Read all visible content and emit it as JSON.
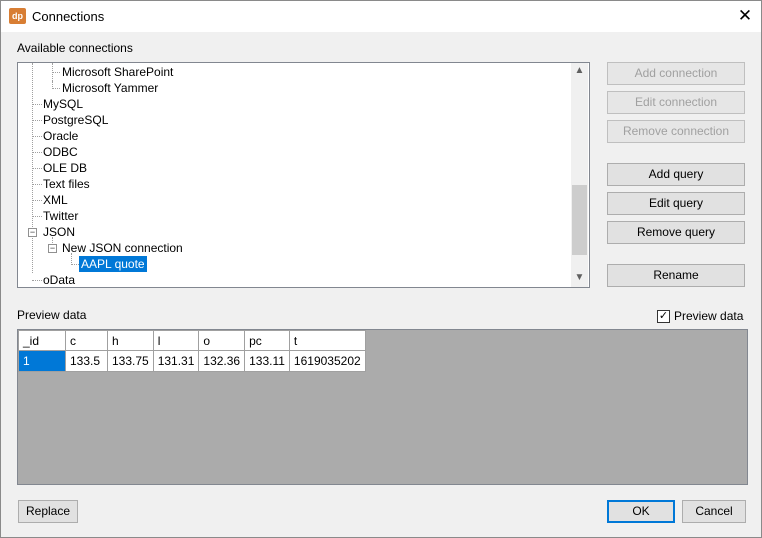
{
  "window": {
    "title": "Connections",
    "app_icon": "dp",
    "close_glyph": "✕"
  },
  "connections": {
    "label": "Available connections",
    "items": [
      {
        "label": "Microsoft SharePoint"
      },
      {
        "label": "Microsoft Yammer"
      },
      {
        "label": "MySQL"
      },
      {
        "label": "PostgreSQL"
      },
      {
        "label": "Oracle"
      },
      {
        "label": "ODBC"
      },
      {
        "label": "OLE DB"
      },
      {
        "label": "Text files"
      },
      {
        "label": "XML"
      },
      {
        "label": "Twitter"
      },
      {
        "label": "JSON"
      },
      {
        "label": "New JSON connection"
      },
      {
        "label": "AAPL quote",
        "selected": true
      },
      {
        "label": "oData"
      }
    ]
  },
  "side_buttons": {
    "add_connection": "Add connection",
    "edit_connection": "Edit connection",
    "remove_connection": "Remove connection",
    "add_query": "Add query",
    "edit_query": "Edit query",
    "remove_query": "Remove query",
    "rename": "Rename"
  },
  "preview": {
    "label": "Preview data",
    "checkbox_label": "Preview data",
    "checkbox_checked": true,
    "checkmark": "✓",
    "columns": [
      "_id",
      "c",
      "h",
      "l",
      "o",
      "pc",
      "t"
    ],
    "rows": [
      [
        "1",
        "133.5",
        "133.75",
        "131.31",
        "132.36",
        "133.11",
        "1619035202"
      ]
    ]
  },
  "footer": {
    "replace": "Replace",
    "ok": "OK",
    "cancel": "Cancel"
  },
  "colors": {
    "selection": "#0078d7",
    "app_icon": "#d87e34",
    "grid_background": "#ababab"
  }
}
